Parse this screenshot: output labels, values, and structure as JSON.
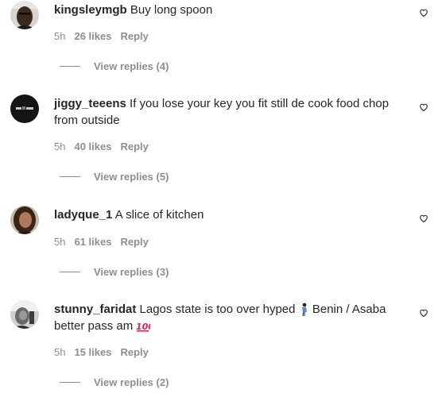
{
  "comments": [
    {
      "username": "kingsleymgb",
      "text": "Buy long spoon",
      "time": "5h",
      "likes": "26 likes",
      "reply": "Reply",
      "view_replies": "View replies (4)"
    },
    {
      "username": "jiggy_teeens",
      "text": "If you lose your key you fit still de cook food chop from outside",
      "time": "5h",
      "likes": "40 likes",
      "reply": "Reply",
      "view_replies": "View replies (5)"
    },
    {
      "username": "ladyque_1",
      "text": "A slice of kitchen",
      "time": "5h",
      "likes": "61 likes",
      "reply": "Reply",
      "view_replies": "View replies (3)"
    },
    {
      "username": "stunny_faridat",
      "text_before": "Lagos state is too over hyped",
      "text_middle": "Benin / Asaba better pass am",
      "time": "5h",
      "likes": "15 likes",
      "reply": "Reply",
      "view_replies": "View replies (2)"
    }
  ],
  "icons": {
    "like": "heart-outline-icon",
    "emoji_1": "person-walking-emoji",
    "emoji_2": "hundred-points-emoji"
  },
  "colors": {
    "text": "#262626",
    "secondary": "#8e8e8e",
    "hundred_emoji": "#e0245e"
  }
}
